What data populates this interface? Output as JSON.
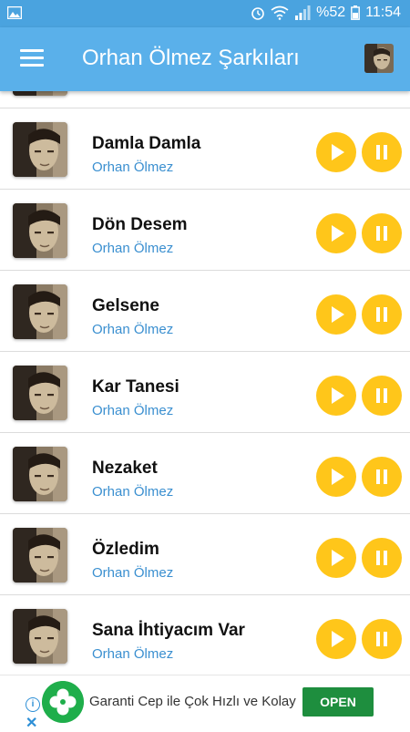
{
  "status_bar": {
    "battery": "%52",
    "time": "11:54",
    "icons": [
      "image-icon",
      "alarm-icon",
      "wifi-icon",
      "signal-icon",
      "battery-icon"
    ]
  },
  "app_bar": {
    "title": "Orhan Ölmez Şarkıları",
    "menu_icon": "hamburger-menu-icon"
  },
  "songs": [
    {
      "title": "Damla Damla",
      "artist": "Orhan Ölmez"
    },
    {
      "title": "Dön Desem",
      "artist": "Orhan Ölmez"
    },
    {
      "title": "Gelsene",
      "artist": "Orhan Ölmez"
    },
    {
      "title": "Kar Tanesi",
      "artist": "Orhan Ölmez"
    },
    {
      "title": "Nezaket",
      "artist": "Orhan Ölmez"
    },
    {
      "title": "Özledim",
      "artist": "Orhan Ölmez"
    },
    {
      "title": "Sana İhtiyacım Var",
      "artist": "Orhan Ölmez"
    }
  ],
  "ad": {
    "text": "Garanti Cep ile Çok Hızlı ve Kolay",
    "button": "OPEN",
    "info_icon": "i",
    "close_icon": "✕"
  },
  "colors": {
    "app_bar": "#5ab0ea",
    "status_bar": "#4aa3df",
    "accent_button": "#ffc61a",
    "artist_text": "#3a8fd0",
    "ad_open": "#1e8e3e"
  }
}
